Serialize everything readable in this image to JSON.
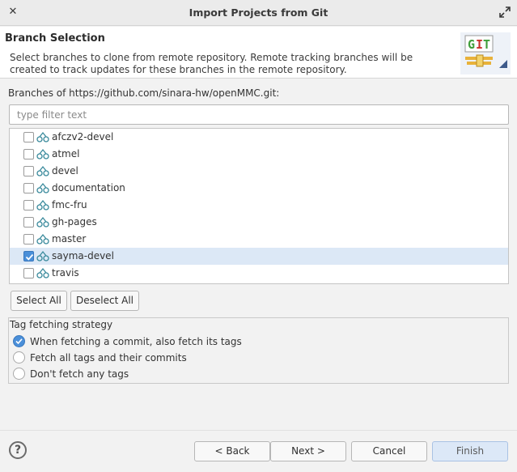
{
  "window": {
    "title": "Import Projects from Git"
  },
  "banner": {
    "heading": "Branch Selection",
    "message": "Select branches to clone from remote repository. Remote tracking branches will be created to track updates for these branches in the remote repository.",
    "logo_text": "GIT"
  },
  "branches": {
    "label": "Branches of https://github.com/sinara-hw/openMMC.git:",
    "filter_placeholder": "type filter text",
    "filter_value": "",
    "items": [
      {
        "label": "afczv2-devel",
        "checked": false,
        "selected": false
      },
      {
        "label": "atmel",
        "checked": false,
        "selected": false
      },
      {
        "label": "devel",
        "checked": false,
        "selected": false
      },
      {
        "label": "documentation",
        "checked": false,
        "selected": false
      },
      {
        "label": "fmc-fru",
        "checked": false,
        "selected": false
      },
      {
        "label": "gh-pages",
        "checked": false,
        "selected": false
      },
      {
        "label": "master",
        "checked": false,
        "selected": false
      },
      {
        "label": "sayma-devel",
        "checked": true,
        "selected": true
      },
      {
        "label": "travis",
        "checked": false,
        "selected": false
      }
    ],
    "select_all_label": "Select All",
    "deselect_all_label": "Deselect All"
  },
  "tag_strategy": {
    "label": "Tag fetching strategy",
    "options": [
      {
        "label": "When fetching a commit, also fetch its tags",
        "selected": true
      },
      {
        "label": "Fetch all tags and their commits",
        "selected": false
      },
      {
        "label": "Don't fetch any tags",
        "selected": false
      }
    ]
  },
  "footer": {
    "help_label": "?",
    "back_label": "< Back",
    "next_label": "Next >",
    "cancel_label": "Cancel",
    "finish_label": "Finish"
  },
  "colors": {
    "accent": "#4a8fd9",
    "selected_row": "#dce8f6",
    "git_green": "#3f9e3a",
    "git_red": "#c9302c"
  }
}
